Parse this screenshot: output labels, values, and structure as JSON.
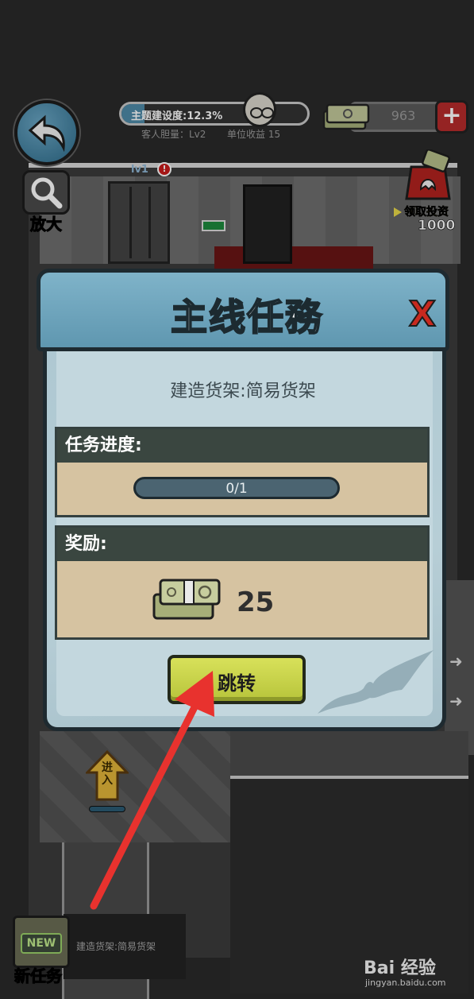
{
  "hud": {
    "build_progress_label": "主题建设度:12.3%",
    "build_progress_value": 0.123,
    "guest_courage": "客人胆量：Lv2",
    "unit_income": "单位收益 15",
    "money": "963",
    "zoom_label": "放大",
    "invest_label": "领取投资",
    "invest_amount": "1000",
    "level_label": "lv1",
    "level_alert": "!"
  },
  "scene": {
    "enter_label": "进入"
  },
  "modal": {
    "title": "主线任務",
    "close_label": "X",
    "task_description": "建造货架:简易货架",
    "progress_header": "任务进度:",
    "progress_text": "0/1",
    "progress_value": 0,
    "reward_header": "奖励:",
    "reward_amount": "25",
    "go_button": "跳转"
  },
  "new_task": {
    "badge": "NEW",
    "label": "新任务",
    "description": "建造货架:简易货架"
  },
  "watermark": {
    "logo": "Bai 经验",
    "url": "jingyan.baidu.com"
  },
  "colors": {
    "accent_blue": "#5f97b0",
    "go_button": "#c9d44b",
    "close_red": "#c8291f",
    "annotation_red": "#e8322e"
  }
}
